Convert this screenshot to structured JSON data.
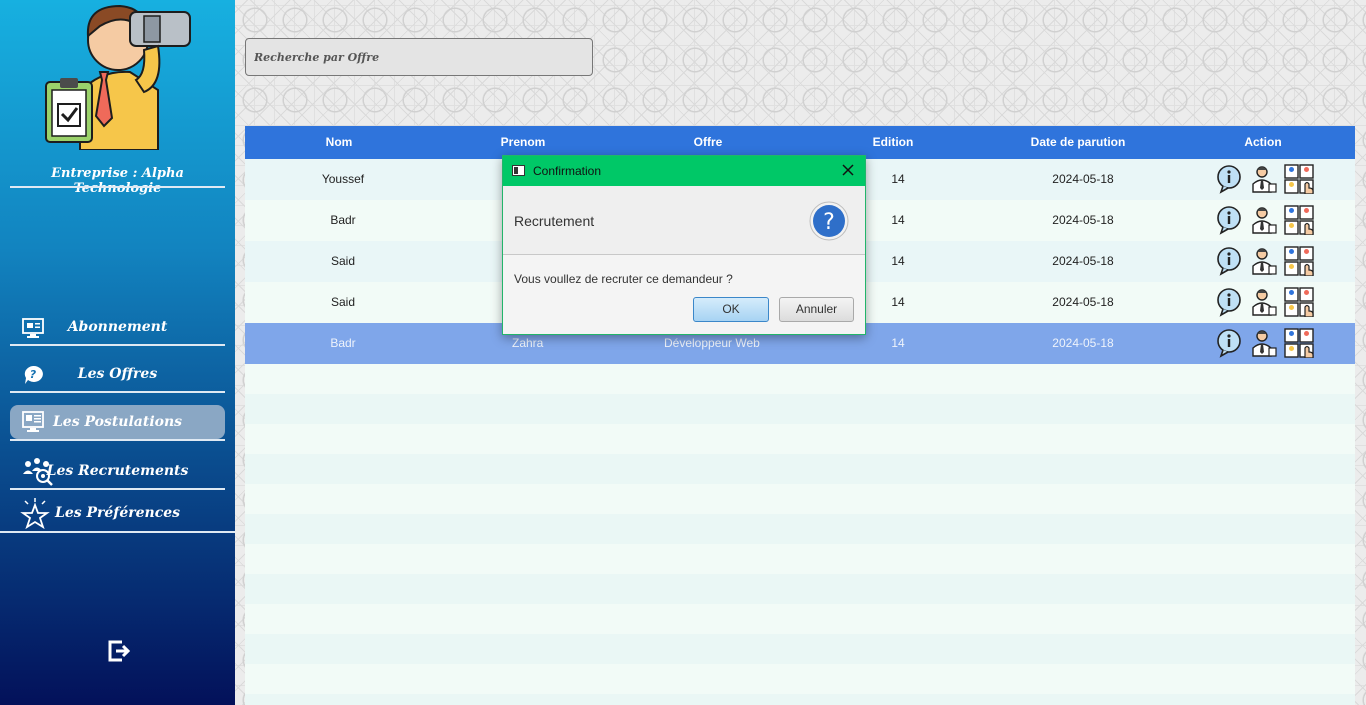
{
  "sidebar": {
    "company": "Entreprise : Alpha Technologie",
    "items": [
      {
        "label": "Abonnement",
        "icon": "monitor-icon"
      },
      {
        "label": "Les Offres",
        "icon": "chat-question-icon"
      },
      {
        "label": "Les Postulations",
        "icon": "postulations-icon"
      },
      {
        "label": "Les Recrutements",
        "icon": "team-search-icon"
      },
      {
        "label": "Les Préférences",
        "icon": "star-icon"
      }
    ],
    "active_index": 2,
    "logout_icon": "logout-icon"
  },
  "search": {
    "placeholder": "Recherche par Offre"
  },
  "table": {
    "headers": [
      "Nom",
      "Prenom",
      "Offre",
      "Edition",
      "Date de parution",
      "Action"
    ],
    "rows": [
      {
        "nom": "Youssef",
        "prenom": "",
        "offre": "",
        "edition": "14",
        "date": "2024-05-18"
      },
      {
        "nom": "Badr",
        "prenom": "",
        "offre": "",
        "edition": "14",
        "date": "2024-05-18"
      },
      {
        "nom": "Said",
        "prenom": "",
        "offre": "",
        "edition": "14",
        "date": "2024-05-18"
      },
      {
        "nom": "Said",
        "prenom": "",
        "offre": "",
        "edition": "14",
        "date": "2024-05-18"
      },
      {
        "nom": "Badr",
        "prenom": "Zahra",
        "offre": "Développeur Web",
        "edition": "14",
        "date": "2024-05-18"
      }
    ],
    "selected_row": 4,
    "action_icons": [
      "info-icon",
      "recruiter-icon",
      "select-candidate-icon"
    ]
  },
  "dialog": {
    "title": "Confirmation",
    "header": "Recrutement",
    "content": "Vous voullez de recruter  ce demandeur ?",
    "ok_label": "OK",
    "cancel_label": "Annuler"
  },
  "colors": {
    "table_header": "#2f74dc",
    "selected_row": "#7fa6ea",
    "dialog_title": "#00c867",
    "sidebar_top": "#17b0e0",
    "sidebar_bottom": "#03115a"
  }
}
